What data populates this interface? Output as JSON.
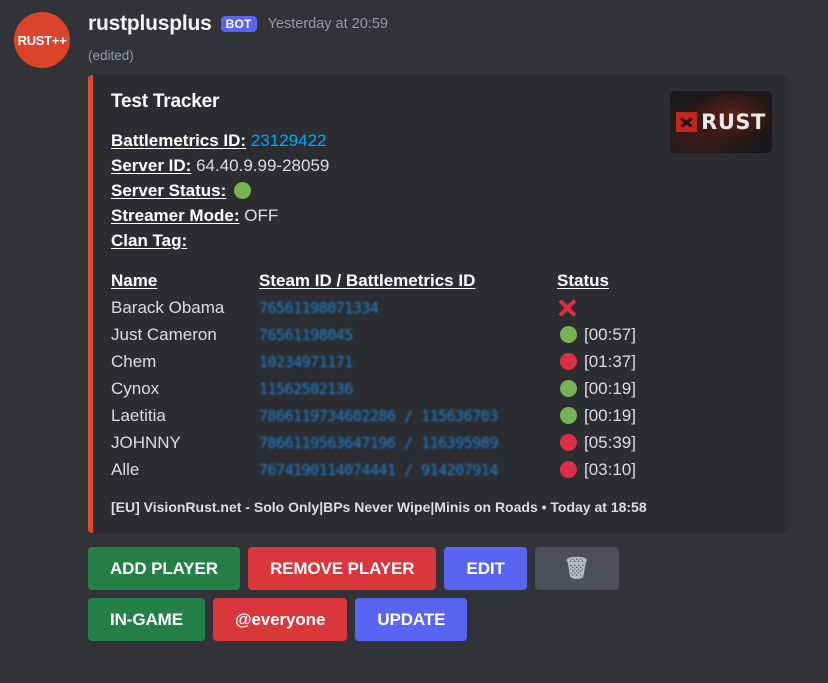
{
  "message": {
    "avatar_text": "RUST++",
    "username": "rustplusplus",
    "bot_badge": "BOT",
    "timestamp": "Yesterday at 20:59",
    "edited_label": "(edited)"
  },
  "embed": {
    "title": "Test Tracker",
    "accent_color": "#e04b2a",
    "thumbnail_alt": "RUST",
    "fields": [
      {
        "key": "Battlemetrics ID:",
        "value": "23129422",
        "style": "link"
      },
      {
        "key": "Server ID:",
        "value": "64.40.9.99-28059",
        "style": "text"
      },
      {
        "key": "Server Status:",
        "value": "",
        "style": "dot-green"
      },
      {
        "key": "Streamer Mode:",
        "value": "OFF",
        "style": "text"
      },
      {
        "key": "Clan Tag:",
        "value": "",
        "style": "text"
      }
    ],
    "table": {
      "headers": [
        "Name",
        "Steam ID / Battlemetrics ID",
        "Status"
      ],
      "rows": [
        {
          "name": "Barack Obama",
          "id": "76561198071334",
          "status": "offline-x",
          "timer": ""
        },
        {
          "name": "Just Cameron",
          "id": "76561198045",
          "status": "green",
          "timer": "[00:57]"
        },
        {
          "name": "Chem",
          "id": "10234971171",
          "status": "red",
          "timer": "[01:37]"
        },
        {
          "name": "Cynox",
          "id": "11562502136",
          "status": "green",
          "timer": "[00:19]"
        },
        {
          "name": "Laetitia",
          "id": "7866119734602286 / 115636703",
          "status": "green",
          "timer": "[00:19]"
        },
        {
          "name": "JOHNNY",
          "id": "7866119563647196 / 116395989",
          "status": "red",
          "timer": "[05:39]"
        },
        {
          "name": "Alle",
          "id": "7674190114074441 / 914207914",
          "status": "red",
          "timer": "[03:10]"
        }
      ]
    },
    "footer": "[EU] VisionRust.net - Solo Only|BPs Never Wipe|Minis on Roads • Today at 18:58"
  },
  "buttons": {
    "row1": [
      {
        "label": "ADD PLAYER",
        "style": "green"
      },
      {
        "label": "REMOVE PLAYER",
        "style": "red"
      },
      {
        "label": "EDIT",
        "style": "blue"
      },
      {
        "label": "🗑",
        "style": "gray",
        "icon": "trash-icon"
      }
    ],
    "row2": [
      {
        "label": "IN-GAME",
        "style": "green"
      },
      {
        "label": "@everyone",
        "style": "red"
      },
      {
        "label": "UPDATE",
        "style": "blue"
      }
    ]
  },
  "colors": {
    "page_bg": "#313338",
    "embed_bg": "#2b2d31",
    "accent": "#e04b2a",
    "blurple": "#5865f2",
    "green_status": "#77b255",
    "red_status": "#dd2e44",
    "link": "#00a8fc"
  }
}
